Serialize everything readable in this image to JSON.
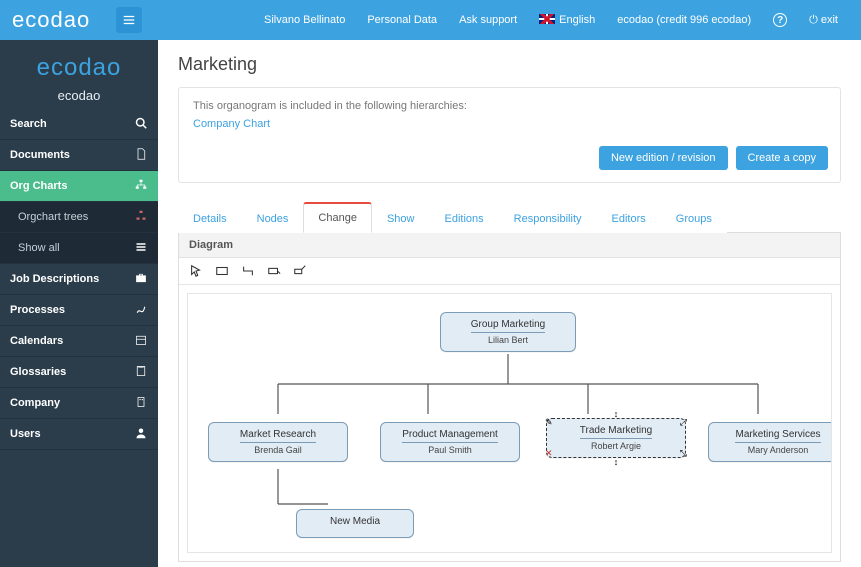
{
  "header": {
    "brand": "ecodao",
    "user": "Silvano Bellinato",
    "personal": "Personal Data",
    "support": "Ask support",
    "lang": "English",
    "credit": "ecodao (credit 996 ecodao)",
    "exit": "exit"
  },
  "sidebar": {
    "brand": "ecodao",
    "sub": "ecodao",
    "items": [
      {
        "label": "Search"
      },
      {
        "label": "Documents"
      },
      {
        "label": "Org Charts"
      },
      {
        "label": "Job Descriptions"
      },
      {
        "label": "Processes"
      },
      {
        "label": "Calendars"
      },
      {
        "label": "Glossaries"
      },
      {
        "label": "Company"
      },
      {
        "label": "Users"
      }
    ],
    "sub1": "Orgchart trees",
    "sub2": "Show all"
  },
  "page": {
    "title": "Marketing",
    "note": "This organogram is included in the following hierarchies:",
    "link": "Company Chart",
    "btn_new": "New edition / revision",
    "btn_copy": "Create a copy"
  },
  "tabs": [
    "Details",
    "Nodes",
    "Change",
    "Show",
    "Editions",
    "Responsibility",
    "Editors",
    "Groups"
  ],
  "diagram": {
    "title": "Diagram",
    "nodes": {
      "root": {
        "t": "Group Marketing",
        "p": "Lilian Bert"
      },
      "n1": {
        "t": "Market Research",
        "p": "Brenda Gail"
      },
      "n2": {
        "t": "Product Management",
        "p": "Paul Smith"
      },
      "n3": {
        "t": "Trade Marketing",
        "p": "Robert Argie"
      },
      "n4": {
        "t": "Marketing Services",
        "p": "Mary Anderson"
      },
      "n5": {
        "t": "New Media",
        "p": ""
      }
    }
  }
}
